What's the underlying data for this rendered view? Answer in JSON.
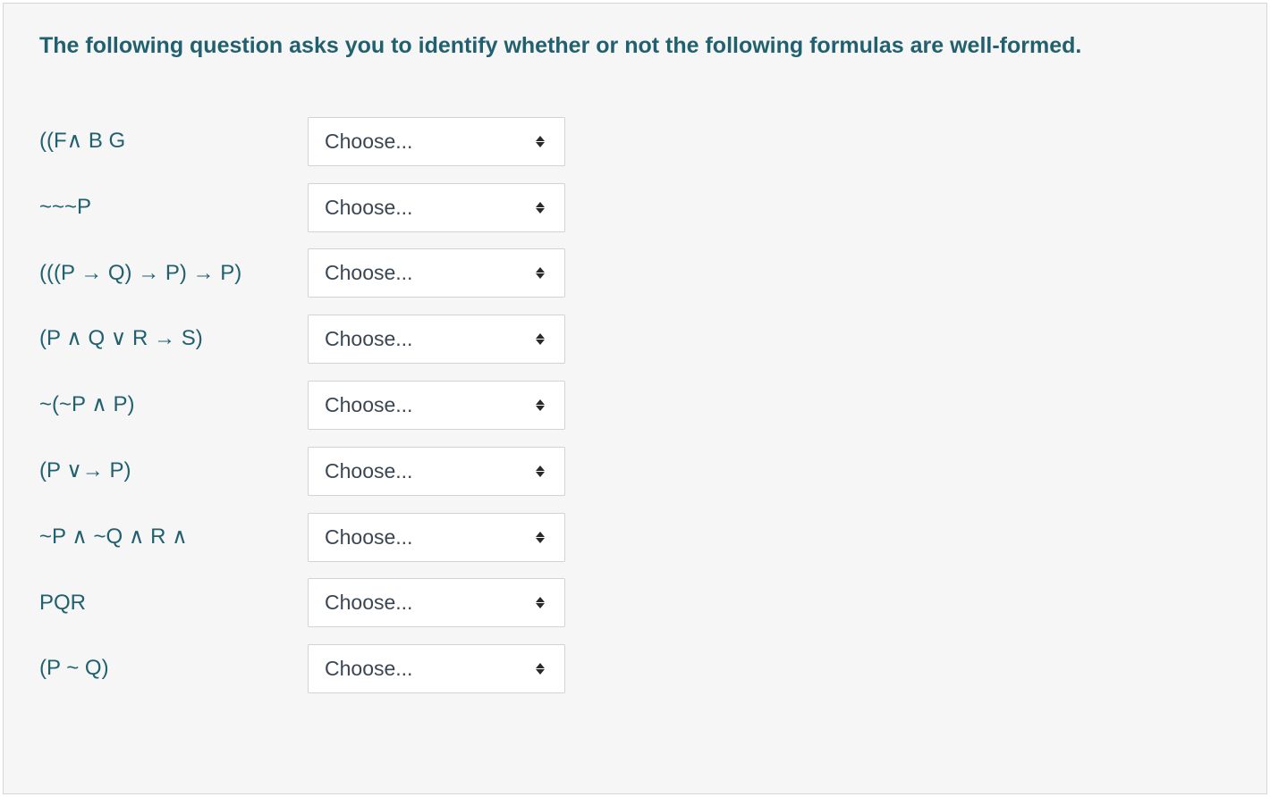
{
  "question": {
    "prompt": "The following question asks you to identify whether or not the following formulas are well-formed."
  },
  "select_placeholder": "Choose...",
  "formulas": [
    {
      "label": "((F∧ B G"
    },
    {
      "label": "~~~P"
    },
    {
      "label": "(((P → Q) → P) → P)"
    },
    {
      "label": "(P ∧ Q ∨ R → S)"
    },
    {
      "label": "~(~P ∧ P)"
    },
    {
      "label": "(P ∨→ P)"
    },
    {
      "label": " ~P ∧ ~Q ∧ R ∧"
    },
    {
      "label": "PQR"
    },
    {
      "label": "(P ~ Q)"
    }
  ]
}
